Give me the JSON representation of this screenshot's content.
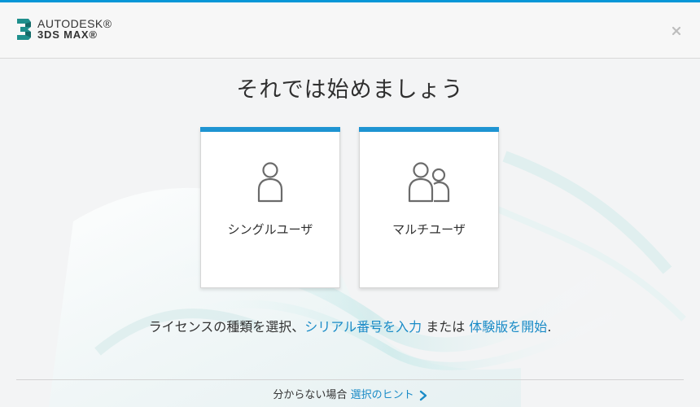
{
  "header": {
    "brand": "AUTODESK®",
    "product": "3DS MAX®",
    "accent_color": "#0696d7"
  },
  "main": {
    "title": "それでは始めましょう",
    "cards": [
      {
        "label": "シングルユーザ",
        "icon": "single-user-icon"
      },
      {
        "label": "マルチユーザ",
        "icon": "multi-user-icon"
      }
    ],
    "instructions": {
      "prefix": "ライセンスの種類を選択、",
      "serial_link": "シリアル番号を入力",
      "middle": " または ",
      "trial_link": "体験版を開始",
      "suffix": "."
    }
  },
  "footer": {
    "text": "分からない場合 ",
    "hint_link": "選択のヒント",
    "link_color": "#1a8bc7"
  }
}
